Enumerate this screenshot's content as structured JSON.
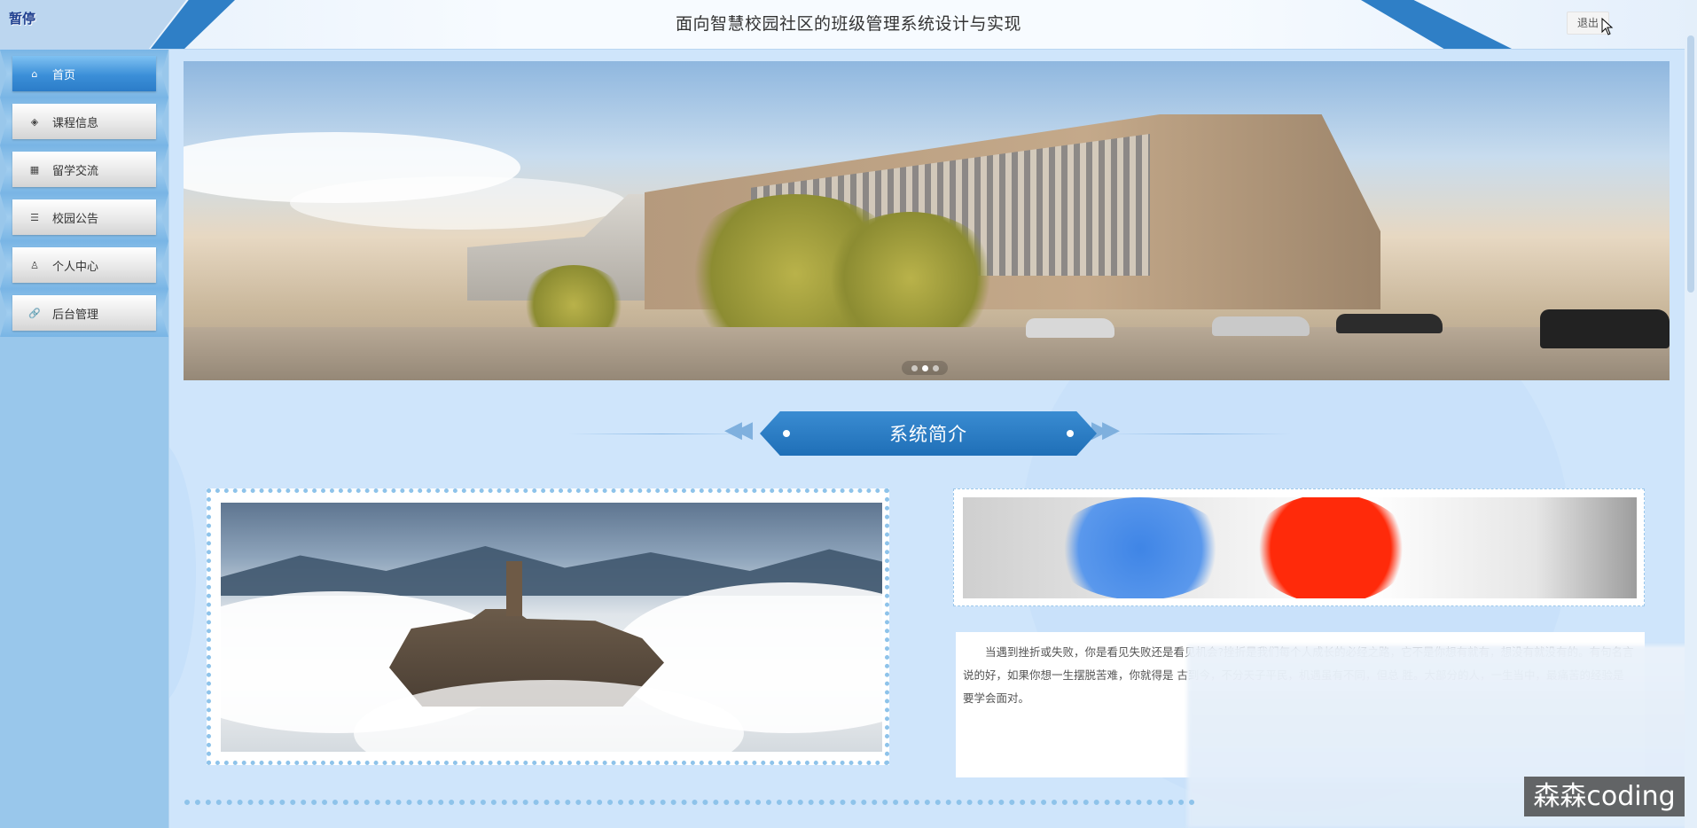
{
  "header": {
    "logo_text": "暂停",
    "title": "面向智慧校园社区的班级管理系统设计与实现",
    "logout_label": "退出"
  },
  "sidebar": {
    "items": [
      {
        "label": "首页",
        "icon": "home-icon",
        "active": true
      },
      {
        "label": "课程信息",
        "icon": "layers-icon",
        "active": false
      },
      {
        "label": "留学交流",
        "icon": "calendar-icon",
        "active": false
      },
      {
        "label": "校园公告",
        "icon": "sliders-icon",
        "active": false
      },
      {
        "label": "个人中心",
        "icon": "user-icon",
        "active": false
      },
      {
        "label": "后台管理",
        "icon": "link-icon",
        "active": false
      }
    ]
  },
  "carousel": {
    "slide_count": 3,
    "active_index": 1
  },
  "intro": {
    "section_title": "系统简介",
    "paragraph": "当遇到挫折或失败，你是看见失败还是看见机会?挫折是我们每个人成长的必经之路，它不是你想有就有，想没有就没有的。有句名言说的好，如果你想一生摆脱苦难，你就得是 古到今，不分天子平民，机遇虽有不同，但总 胜。大部分的人，一生当中，最痛苦的经验是 要学会面对。"
  },
  "overlay": {
    "watermark": "森森coding"
  },
  "colors": {
    "accent": "#2f7fc6",
    "sidebar_bg": "#99c7eb",
    "page_bg": "#cfe5fb"
  }
}
